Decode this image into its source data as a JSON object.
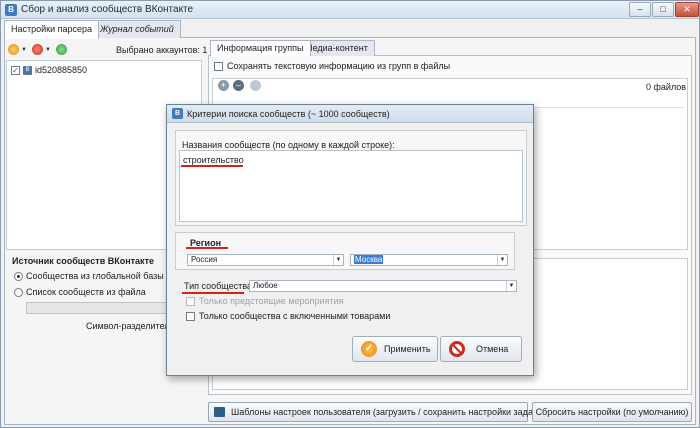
{
  "window": {
    "title": "Сбор и анализ сообществ ВКонтакте",
    "controls": {
      "minimize": "–",
      "maximize": "□",
      "close": "✕"
    }
  },
  "main_tabs": [
    {
      "label": "Настройки парсера",
      "active": true
    },
    {
      "label": "Журнал событий",
      "active": false
    }
  ],
  "accounts": {
    "selected_label": "Выбрано аккаунтов: 1",
    "items": [
      {
        "id": "id520885850",
        "checked": true
      }
    ]
  },
  "source": {
    "title": "Источник сообществ ВКонтакте",
    "option_global": "Сообщества из глобальной базы ВКонта",
    "option_file": "Список сообществ из файла",
    "separator_label": "Символ-разделитель:"
  },
  "right_tabs": [
    {
      "label": "Информация группы",
      "active": true
    },
    {
      "label": "Медиа-контент",
      "active": false
    }
  ],
  "info": {
    "save_text_label": "Сохранять текстовую информацию из групп в файлы",
    "files_count": "0 файлов"
  },
  "bottom": {
    "templates_button": "Шаблоны настроек пользователя (загрузить / сохранить настройки задачи)",
    "reset_button": "Сбросить настройки (по умолчанию)"
  },
  "dialog": {
    "title": "Критерии поиска сообществ (~ 1000 сообществ)",
    "names_label": "Названия сообществ (по одному в каждой строке):",
    "names_value": "строительство",
    "region_label": "Регион",
    "country_value": "Россия",
    "city_value": "Москва",
    "type_label": "Тип сообщества:",
    "type_value": "Любое",
    "upcoming_label": "Только предстоящие мероприятия",
    "goods_label": "Только сообщества с включенными товарами",
    "apply_button": "Применить",
    "cancel_button": "Отмена"
  },
  "colors": {
    "accent_underline": "#d5221a",
    "selection": "#3a7bd5"
  }
}
